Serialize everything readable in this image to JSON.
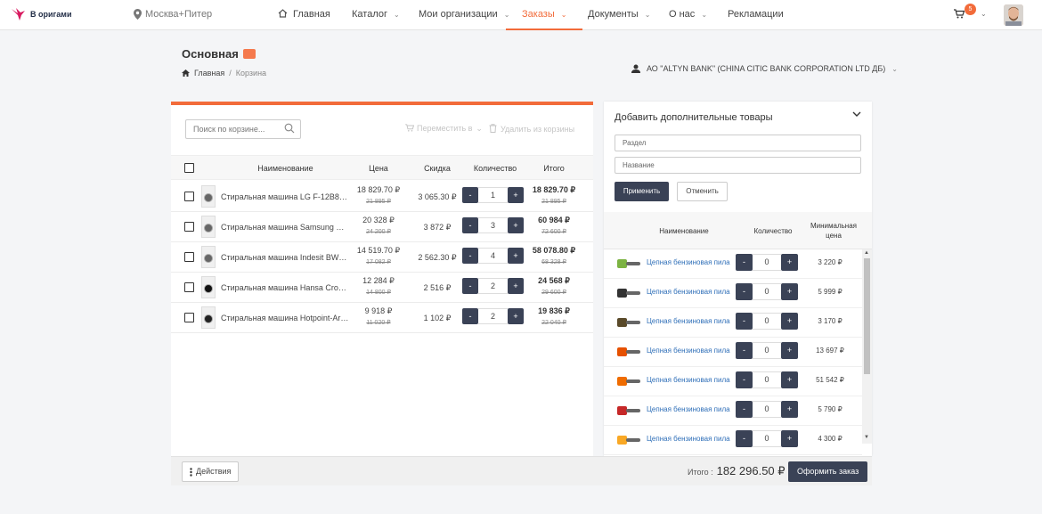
{
  "header": {
    "logo": "В оригами",
    "city": "Москва+Питер",
    "nav": [
      {
        "label": "Главная",
        "chevron": false,
        "active": false,
        "icon": "home-icon"
      },
      {
        "label": "Каталог",
        "chevron": true,
        "active": false
      },
      {
        "label": "Мои организации",
        "chevron": true,
        "active": false
      },
      {
        "label": "Заказы",
        "chevron": true,
        "active": true
      },
      {
        "label": "Документы",
        "chevron": true,
        "active": false
      },
      {
        "label": "О нас",
        "chevron": true,
        "active": false
      },
      {
        "label": "Рекламации",
        "chevron": false,
        "active": false
      }
    ],
    "cart_count": "5"
  },
  "page": {
    "title": "Основная",
    "breadcrumb": [
      "Главная",
      "/",
      "Корзина"
    ],
    "organization": "АО \"ALTYN BANK\" (CHINA CITIC BANK CORPORATION LTD ДБ)"
  },
  "cart": {
    "search_placeholder": "Поиск по корзине...",
    "move_label": "Переместить в",
    "remove_label": "Удалить из корзины",
    "columns": {
      "name": "Наименование",
      "price": "Цена",
      "discount": "Скидка",
      "quantity": "Количество",
      "total": "Итого"
    },
    "items": [
      {
        "name": "Стиральная машина LG F-12B8WD8",
        "price": "18 829.70 ₽",
        "old_price": "21 895 ₽",
        "discount": "3 065.30 ₽",
        "qty": "1",
        "total": "18 829.70 ₽",
        "old_total": "21 895 ₽"
      },
      {
        "name": "Стиральная машина Samsung WW6...",
        "price": "20 328 ₽",
        "old_price": "24 200 ₽",
        "discount": "3 872 ₽",
        "qty": "3",
        "total": "60 984 ₽",
        "old_total": "72 600 ₽"
      },
      {
        "name": "Стиральная машина Indesit BWSE 8...",
        "price": "14 519.70 ₽",
        "old_price": "17 082 ₽",
        "discount": "2 562.30 ₽",
        "qty": "4",
        "total": "58 078.80 ₽",
        "old_total": "68 328 ₽"
      },
      {
        "name": "Стиральная машина Hansa Crown ...",
        "price": "12 284 ₽",
        "old_price": "14 800 ₽",
        "discount": "2 516 ₽",
        "qty": "2",
        "total": "24 568 ₽",
        "old_total": "29 600 ₽"
      },
      {
        "name": "Стиральная машина Hotpoint-Aristo...",
        "price": "9 918 ₽",
        "old_price": "11 020 ₽",
        "discount": "1 102 ₽",
        "qty": "2",
        "total": "19 836 ₽",
        "old_total": "22 040 ₽"
      }
    ],
    "actions_label": "Действия",
    "total_label": "Итого :",
    "total_value": "182 296.50 ₽",
    "order_button": "Оформить заказ"
  },
  "addons": {
    "title": "Добавить дополнительные товары",
    "section_placeholder": "Раздел",
    "name_placeholder": "Название",
    "apply_button": "Применить",
    "cancel_button": "Отменить",
    "columns": {
      "name": "Наименование",
      "quantity": "Количество",
      "min_price": "Минимальная цена"
    },
    "items": [
      {
        "name": "Цепная бензиновая пила",
        "qty": "0",
        "min_price": "3 220 ₽",
        "color": "#7cb342"
      },
      {
        "name": "Цепная бензиновая пила",
        "qty": "0",
        "min_price": "5 999 ₽",
        "color": "#333333"
      },
      {
        "name": "Цепная бензиновая пила",
        "qty": "0",
        "min_price": "3 170 ₽",
        "color": "#5a4a2a"
      },
      {
        "name": "Цепная бензиновая пила",
        "qty": "0",
        "min_price": "13 697 ₽",
        "color": "#e65100"
      },
      {
        "name": "Цепная бензиновая пила",
        "qty": "0",
        "min_price": "51 542 ₽",
        "color": "#ef6c00"
      },
      {
        "name": "Цепная бензиновая пила",
        "qty": "0",
        "min_price": "5 790 ₽",
        "color": "#c62828"
      },
      {
        "name": "Цепная бензиновая пила",
        "qty": "0",
        "min_price": "4 300 ₽",
        "color": "#f9a825"
      }
    ]
  },
  "colors": {
    "accent": "#f26b3a",
    "dark_button": "#3a4256",
    "link": "#2f6fb8"
  }
}
